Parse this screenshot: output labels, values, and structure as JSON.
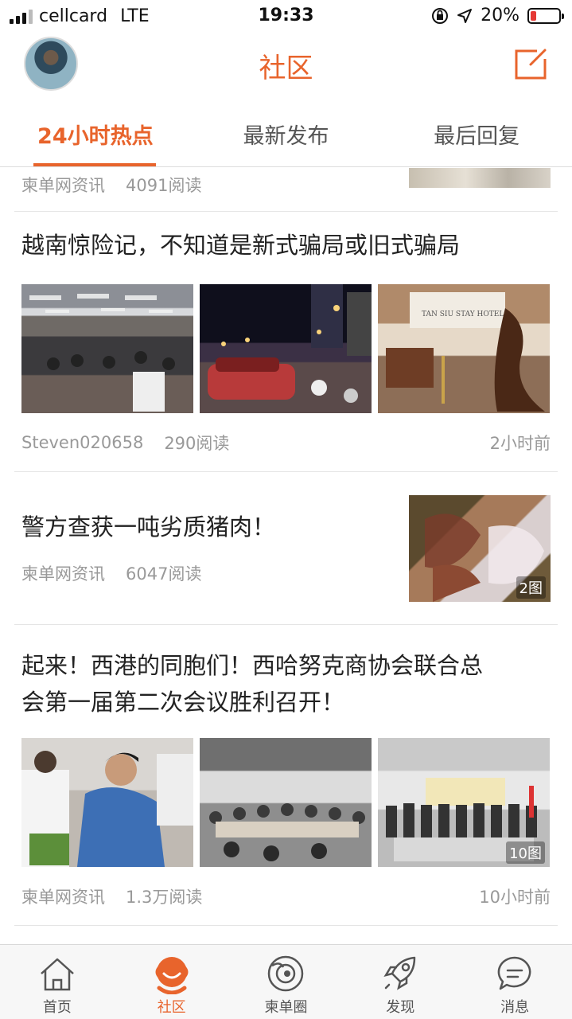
{
  "status_bar": {
    "carrier": "cellcard",
    "network": "LTE",
    "time": "19:33",
    "battery": "20%",
    "battery_level": 0.2
  },
  "header": {
    "title": "社区"
  },
  "tabs": [
    {
      "label": "24小时热点",
      "active": true
    },
    {
      "label": "最新发布",
      "active": false
    },
    {
      "label": "最后回复",
      "active": false
    }
  ],
  "feed": [
    {
      "source": "柬单网资讯",
      "reads": "4091阅读"
    },
    {
      "title": "越南惊险记，不知道是新式骗局或旧式骗局",
      "source": "Steven020658",
      "reads": "290阅读",
      "time": "2小时前"
    },
    {
      "title": "警方查获一吨劣质猪肉！",
      "source": "柬单网资讯",
      "reads": "6047阅读",
      "image_count": "2图"
    },
    {
      "title_line1": "起来！西港的同胞们！西哈努克商协会联合总",
      "title_line2": "会第一届第二次会议胜利召开！",
      "source": "柬单网资讯",
      "reads": "1.3万阅读",
      "time": "10小时前",
      "image_count": "10图"
    }
  ],
  "bottom_nav": [
    {
      "label": "首页",
      "icon": "home-icon"
    },
    {
      "label": "社区",
      "icon": "community-icon",
      "active": true
    },
    {
      "label": "柬单圈",
      "icon": "circle-icon"
    },
    {
      "label": "发现",
      "icon": "rocket-icon"
    },
    {
      "label": "消息",
      "icon": "message-icon"
    }
  ],
  "colors": {
    "accent": "#e8642c",
    "muted": "#999999"
  }
}
